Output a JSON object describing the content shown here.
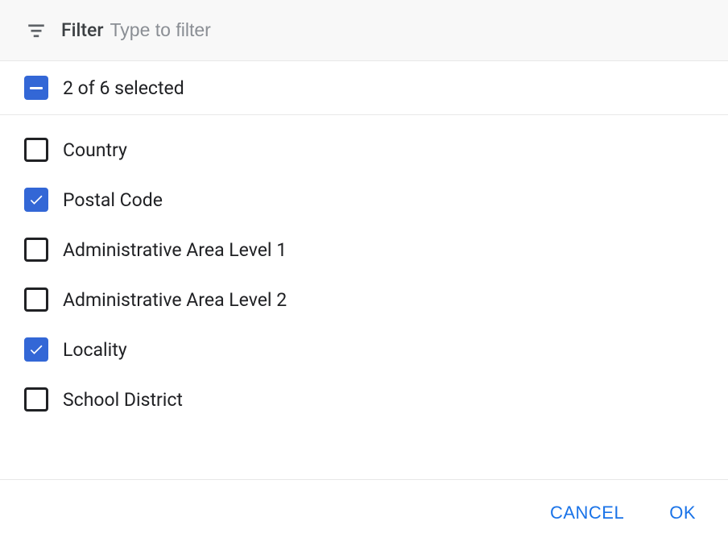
{
  "filter": {
    "label": "Filter",
    "placeholder": "Type to filter",
    "value": ""
  },
  "selection": {
    "summary": "2 of 6 selected"
  },
  "options": [
    {
      "label": "Country",
      "checked": false
    },
    {
      "label": "Postal Code",
      "checked": true
    },
    {
      "label": "Administrative Area Level 1",
      "checked": false
    },
    {
      "label": "Administrative Area Level 2",
      "checked": false
    },
    {
      "label": "Locality",
      "checked": true
    },
    {
      "label": "School District",
      "checked": false
    }
  ],
  "actions": {
    "cancel": "CANCEL",
    "ok": "OK"
  }
}
